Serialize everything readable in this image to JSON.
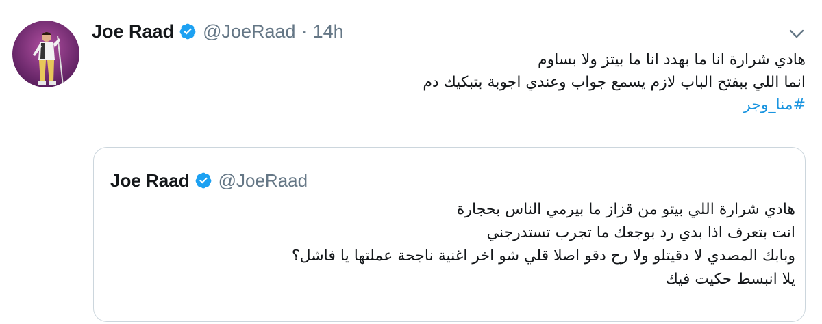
{
  "tweet": {
    "author": {
      "display_name": "Joe Raad",
      "handle": "@JoeRaad",
      "verified": true,
      "avatar_icon": "profile-photo"
    },
    "separator": "·",
    "timestamp": "14h",
    "menu_icon": "chevron-down-icon",
    "text_lines": [
      "هادي شرارة انا ما بهدد انا ما بيتز ولا بساوم",
      "انما اللي ببفتح الباب لازم يسمع جواب وعندي اجوبة بتبكيك دم"
    ],
    "hashtag": "#منا_وجر"
  },
  "quoted_tweet": {
    "author": {
      "display_name": "Joe Raad",
      "handle": "@JoeRaad",
      "verified": true
    },
    "text_lines": [
      "هادي شرارة اللي بيتو من قزاز ما بيرمي الناس بحجارة",
      "انت بتعرف اذا بدي رد بوجعك ما تجرب تستدرجني",
      "وبابك المصدي لا دقيتلو ولا رح دقو اصلا قلي شو اخر اغنية ناجحة عملتها يا فاشل؟",
      "يلا انبسط حكيت فيك"
    ]
  },
  "colors": {
    "text_primary": "#14171a",
    "text_secondary": "#657786",
    "link": "#1b95e0",
    "verified_badge": "#1da1f2",
    "border": "#ccd6dd"
  }
}
